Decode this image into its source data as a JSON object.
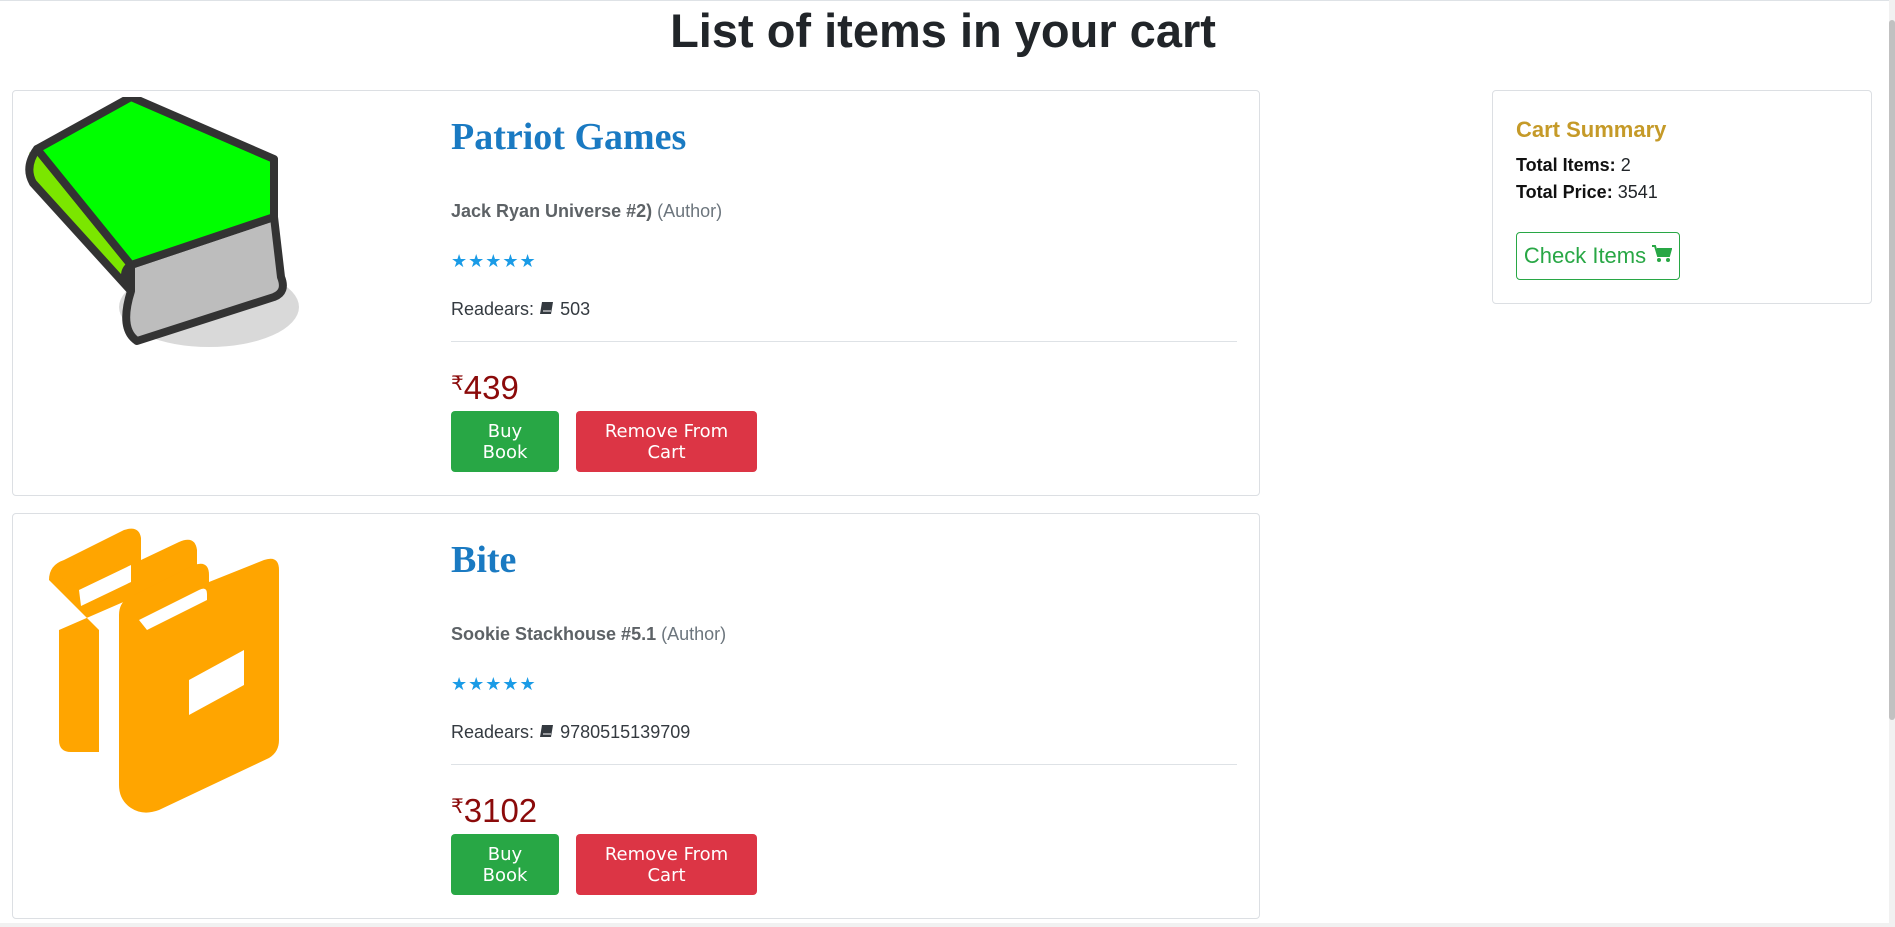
{
  "page": {
    "title": "List of items in your cart"
  },
  "cart_items": [
    {
      "title": "Patriot Games",
      "series": "Jack Ryan Universe #2)",
      "author_suffix": "(Author)",
      "stars": "★★★★★",
      "readers_label": "Readears:",
      "readers_value": "503",
      "currency": "₹",
      "price": "439",
      "buy_label": "Buy Book",
      "remove_label": "Remove From Cart",
      "image_icon": "green-book-icon"
    },
    {
      "title": "Bite",
      "series": "Sookie Stackhouse #5.1",
      "author_suffix": "(Author)",
      "stars": "★★★★★",
      "readers_label": "Readears:",
      "readers_value": "9780515139709",
      "currency": "₹",
      "price": "3102",
      "buy_label": "Buy Book",
      "remove_label": "Remove From Cart",
      "image_icon": "orange-books-icon"
    }
  ],
  "summary": {
    "title": "Cart Summary",
    "total_items_label": "Total Items:",
    "total_items_value": "2",
    "total_price_label": "Total Price:",
    "total_price_value": "3541",
    "check_label": "Check Items"
  },
  "colors": {
    "buy": "#28a745",
    "remove": "#dc3545",
    "title_link": "#1a7ac2",
    "price": "#8b0a0a",
    "summary_title": "#c59a28",
    "stars": "#1a9be6"
  }
}
